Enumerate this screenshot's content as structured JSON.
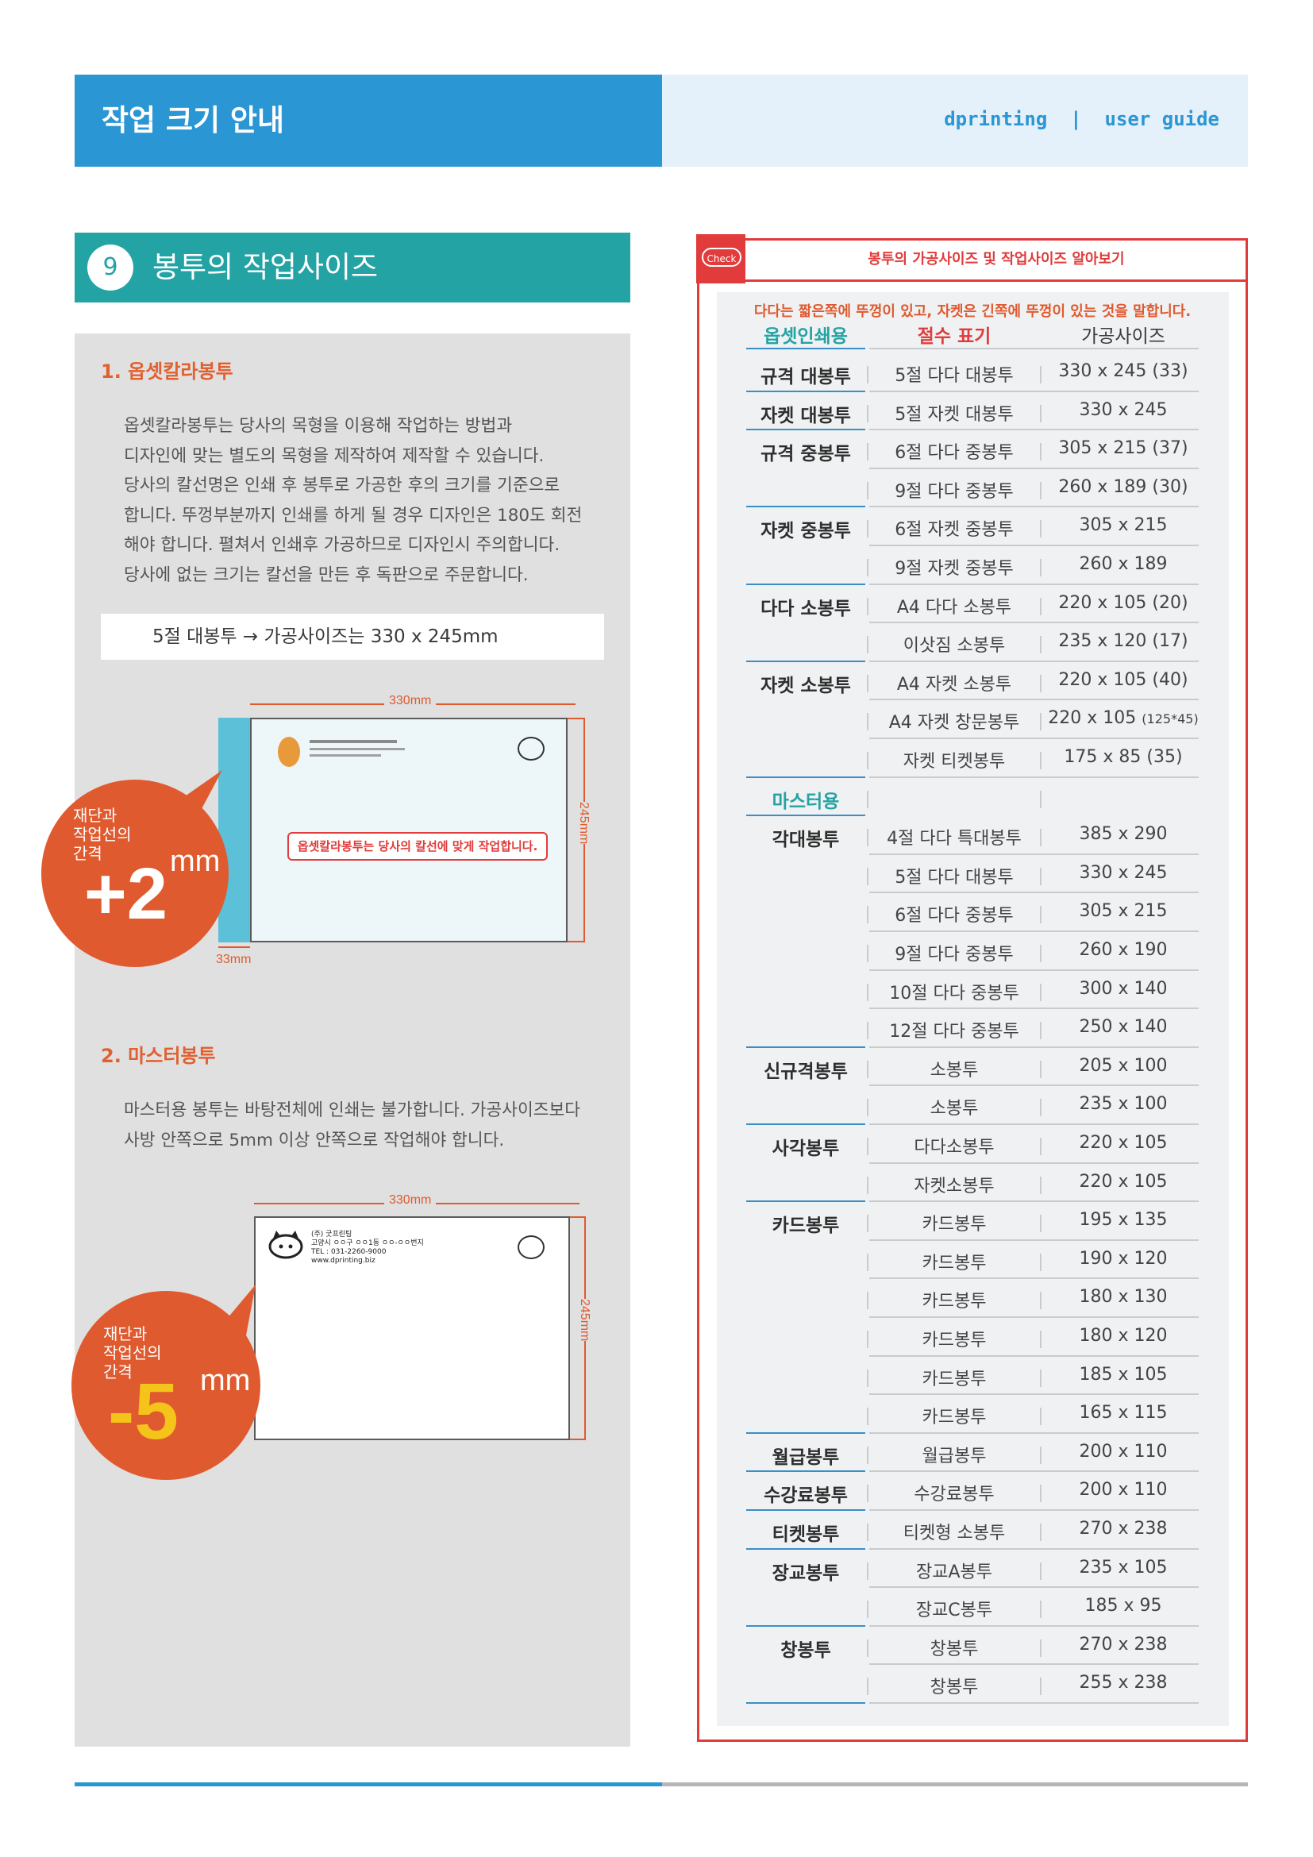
{
  "header": {
    "title": "작업 크기 안내",
    "brand": "dprinting  |  user guide"
  },
  "section": {
    "number": "9",
    "title": "봉투의 작업사이즈"
  },
  "offset": {
    "heading": "1. 옵셋칼라봉투",
    "lines": [
      "옵셋칼라봉투는 당사의 목형을 이용해 작업하는 방법과",
      "디자인에 맞는 별도의 목형을 제작하여 제작할 수 있습니다.",
      "당사의 칼선명은 인쇄 후 봉투로 가공한 후의 크기를 기준으로",
      "합니다.  뚜껑부분까지 인쇄를 하게 될 경우 디자인은 180도 회전",
      "해야 합니다. 펼쳐서 인쇄후 가공하므로 디자인시 주의합니다.",
      "당사에 없는 크기는 칼선을 만든 후 독판으로 주문합니다."
    ],
    "example": "5절 대봉투  →  가공사이즈는 330 x 245mm",
    "diagram": {
      "width_label": "330mm",
      "height_label": "245mm",
      "flap_label": "33mm",
      "notice": "옵셋칼라봉투는 당사의 칼선에 맞게 작업합니다.",
      "bubble_lines": [
        "재단과",
        "작업선의",
        "간격"
      ],
      "bubble_value": "+2",
      "bubble_unit": "mm"
    }
  },
  "master": {
    "heading": "2. 마스터봉투",
    "lines": [
      "마스터용 봉투는 바탕전체에 인쇄는 불가합니다. 가공사이즈보다",
      "사방 안쪽으로 5mm 이상 안쪽으로 작업해야 합니다."
    ],
    "diagram": {
      "width_label": "330mm",
      "height_label": "245mm",
      "logo_lines": [
        "(주) 굿프린팅",
        "고양시 ㅇㅇ구 ㅇㅇ1동 ㅇㅇ-ㅇㅇ번지",
        "TEL : 031-2260-9000",
        "www.dprinting.biz"
      ],
      "bubble_lines": [
        "재단과",
        "작업선의",
        "간격"
      ],
      "bubble_value": "-5",
      "bubble_unit": "mm"
    }
  },
  "table": {
    "check_label": "Check",
    "title": "봉투의 가공사이즈 및 작업사이즈 알아보기",
    "note": "다다는 짧은쪽에 뚜껑이 있고, 자켓은 긴쪽에 뚜껑이 있는 것을 말합니다.",
    "col_category": "옵셋인쇄용",
    "col_cut": "절수 표기",
    "col_size": "가공사이즈",
    "section2_label": "마스터용",
    "offset_rows": [
      [
        "규격 대봉투",
        "5절 다다 대봉투",
        "330 x 245 (33)"
      ],
      [
        "자켓 대봉투",
        "5절 자켓 대봉투",
        "330 x 245"
      ],
      [
        "규격 중봉투",
        "6절 다다 중봉투",
        "305 x 215 (37)"
      ],
      [
        "",
        "9절 다다 중봉투",
        "260 x 189 (30)"
      ],
      [
        "자켓 중봉투",
        "6절 자켓 중봉투",
        "305 x 215"
      ],
      [
        "",
        "9절 자켓 중봉투",
        "260 x 189"
      ],
      [
        "다다 소봉투",
        "A4 다다 소봉투",
        "220 x 105 (20)"
      ],
      [
        "",
        "이삿짐 소봉투",
        "235 x 120 (17)"
      ],
      [
        "자켓 소봉투",
        "A4 자켓 소봉투",
        "220 x 105 (40)"
      ],
      [
        "",
        "A4 자켓 창문봉투",
        "220 x 105"
      ],
      [
        "",
        "자켓 티켓봉투",
        "175 x 85 (35)"
      ]
    ],
    "window_extra": "(125*45)",
    "master_rows": [
      [
        "각대봉투",
        "4절 다다 특대봉투",
        "385 x 290"
      ],
      [
        "",
        "5절 다다 대봉투",
        "330 x 245"
      ],
      [
        "",
        "6절 다다 중봉투",
        "305 x 215"
      ],
      [
        "",
        "9절 다다 중봉투",
        "260 x 190"
      ],
      [
        "",
        "10절 다다 중봉투",
        "300 x 140"
      ],
      [
        "",
        "12절 다다 중봉투",
        "250 x 140"
      ],
      [
        "신규격봉투",
        "소봉투",
        "205 x 100"
      ],
      [
        "",
        "소봉투",
        "235 x 100"
      ],
      [
        "사각봉투",
        "다다소봉투",
        "220 x 105"
      ],
      [
        "",
        "자켓소봉투",
        "220 x 105"
      ],
      [
        "카드봉투",
        "카드봉투",
        "195 x 135"
      ],
      [
        "",
        "카드봉투",
        "190 x 120"
      ],
      [
        "",
        "카드봉투",
        "180 x 130"
      ],
      [
        "",
        "카드봉투",
        "180 x 120"
      ],
      [
        "",
        "카드봉투",
        "185 x 105"
      ],
      [
        "",
        "카드봉투",
        "165 x 115"
      ],
      [
        "월급봉투",
        "월급봉투",
        "200 x 110"
      ],
      [
        "수강료봉투",
        "수강료봉투",
        "200 x 110"
      ],
      [
        "티켓봉투",
        "티켓형 소봉투",
        "270 x 238"
      ],
      [
        "장교봉투",
        "장교A봉투",
        "235 x 105"
      ],
      [
        "",
        "장교C봉투",
        "185 x 95"
      ],
      [
        "창봉투",
        "창봉투",
        "270 x 238"
      ],
      [
        "",
        "창봉투",
        "255 x 238"
      ]
    ]
  },
  "colors": {
    "header_blue": "#2a96d4",
    "teal": "#24a3a4",
    "accent_red": "#e23b3b",
    "orange": "#e05a2f"
  }
}
